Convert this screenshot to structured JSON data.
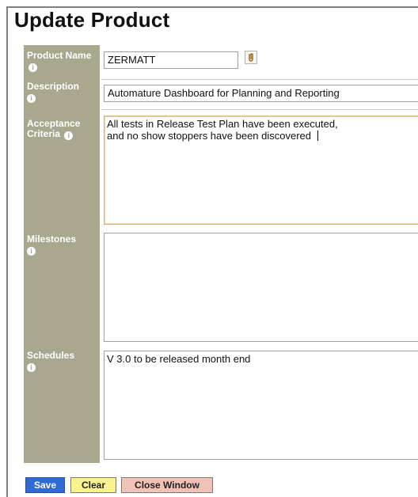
{
  "page": {
    "title": "Update Product"
  },
  "form": {
    "product_name": {
      "label": "Product Name",
      "value": "ZERMATT"
    },
    "description": {
      "label": "Description",
      "value": "Automature Dashboard for Planning and Reporting"
    },
    "acceptance_criteria": {
      "label": "Acceptance Criteria",
      "value": "All tests in Release Test Plan have been executed,\nand no show stoppers have been discovered"
    },
    "milestones": {
      "label": "Milestones",
      "value": ""
    },
    "schedules": {
      "label": "Schedules",
      "value": "V 3.0 to be released month end"
    }
  },
  "buttons": {
    "save": "Save",
    "clear": "Clear",
    "close_window": "Close Window"
  },
  "icons": {
    "info": "info-icon",
    "attachment": "paperclip-icon"
  },
  "colors": {
    "label_column": "#a9a88f",
    "save_button": "#2f6ad6",
    "clear_button": "#fbf38d",
    "close_button": "#f2c2b6",
    "active_field_border": "#e2b270"
  }
}
